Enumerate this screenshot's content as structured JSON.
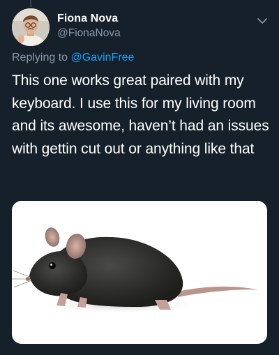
{
  "tweet": {
    "author": {
      "display_name": "Fiona Nova",
      "handle": "@FionaNova",
      "avatar_icon": "avatar-icon"
    },
    "reply": {
      "prefix": "Replying to ",
      "mention": "@GavinFree"
    },
    "text": "This one works great paired with my keyboard. I use this for my living room and its awesome, haven’t had an issues with gettin cut out or anything like that",
    "media": {
      "icon": "mouse-animal-photo"
    },
    "menu_icon": "chevron-down-icon"
  },
  "colors": {
    "background": "#15202b",
    "text_primary": "#ffffff",
    "text_secondary": "#8899a6",
    "link": "#1da1f2",
    "thread_line": "#38444d"
  }
}
